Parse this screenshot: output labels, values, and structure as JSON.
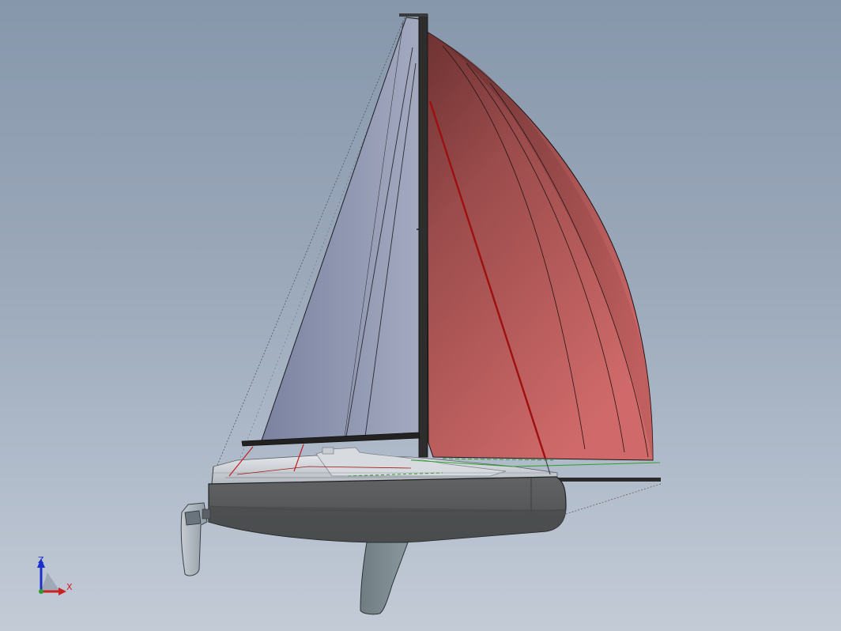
{
  "viewport": {
    "background_top": "#8797ab",
    "background_bottom": "#c3cbd6"
  },
  "model": {
    "hull_color": "#5a5c5e",
    "hull_bottom_color": "#4a4c4e",
    "deck_color": "#c9ced4",
    "mainsail_color": "#8c94ad",
    "spinnaker_color": "#b35a5a",
    "keel_color": "#7d8a8f",
    "rudder_color": "#a6b0b8",
    "mast_color": "#2a2a2a",
    "rigging_red": "#b01818",
    "rigging_green": "#2da02d"
  },
  "triad": {
    "z_label": "Z",
    "x_label": "X",
    "z_color": "#1a2fcc",
    "x_color": "#cc2020"
  }
}
